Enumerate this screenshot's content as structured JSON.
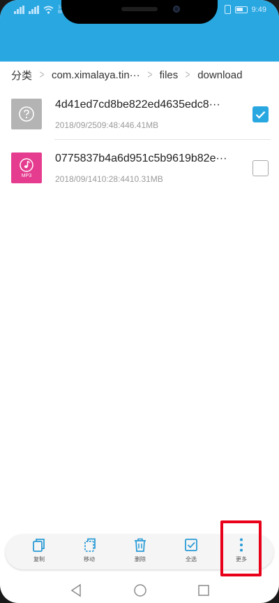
{
  "status_bar": {
    "net_speed": "147 B/s",
    "time": "9:49"
  },
  "breadcrumb": [
    {
      "label": "分类"
    },
    {
      "label": "com.ximalaya.tin···"
    },
    {
      "label": "files"
    },
    {
      "label": "download"
    }
  ],
  "files": [
    {
      "name": "4d41ed7cd8be822ed4635edc8···",
      "meta": "2018/09/2509:48:446.41MB",
      "icon": "unknown-file-icon",
      "checked": true
    },
    {
      "name": "0775837b4a6d951c5b9619b82e···",
      "meta": "2018/09/1410:28:4410.31MB",
      "icon": "mp3-file-icon",
      "icon_text": "MP3",
      "checked": false
    }
  ],
  "toolbar": {
    "copy_label": "复制",
    "move_label": "移动",
    "delete_label": "删除",
    "select_all_label": "全选",
    "more_label": "更多"
  },
  "colors": {
    "accent": "#29a7e1",
    "mp3": "#e53c8f",
    "highlight": "#e8001a"
  }
}
